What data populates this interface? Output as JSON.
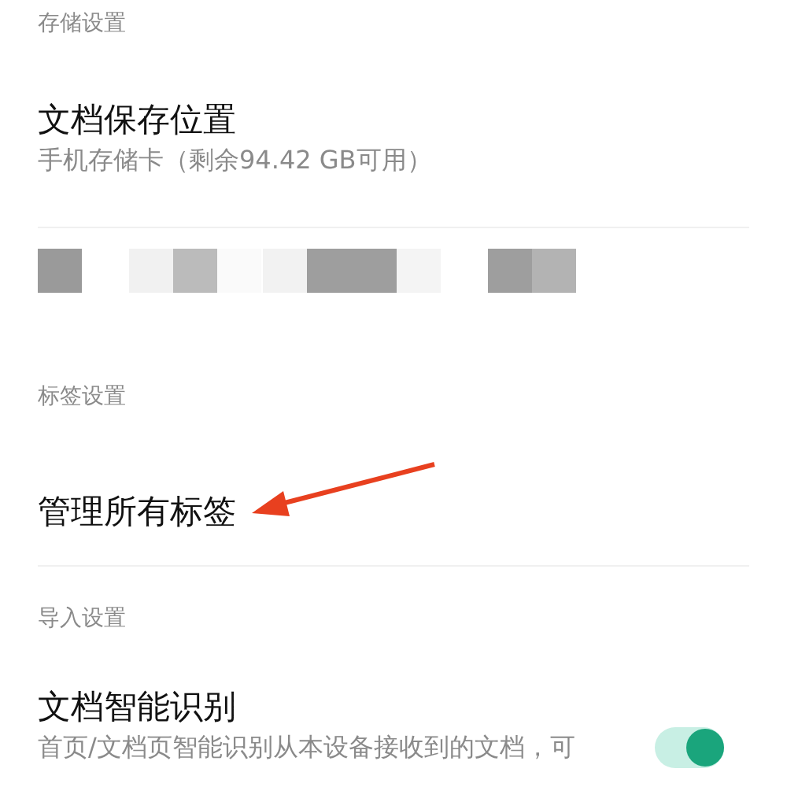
{
  "sections": [
    {
      "header": "存储设置",
      "items": [
        {
          "kind": "detail",
          "title": "文档保存位置",
          "subtitle": "手机存储卡（剩余94.42 GB可用）"
        },
        {
          "kind": "redacted"
        }
      ]
    },
    {
      "header": "标签设置",
      "items": [
        {
          "kind": "link",
          "title": "管理所有标签"
        }
      ]
    },
    {
      "header": "导入设置",
      "items": [
        {
          "kind": "toggle",
          "title": "文档智能识别",
          "subtitle": "首页/文档页智能识别从本设备接收到的文档，可",
          "on": true
        }
      ]
    }
  ]
}
